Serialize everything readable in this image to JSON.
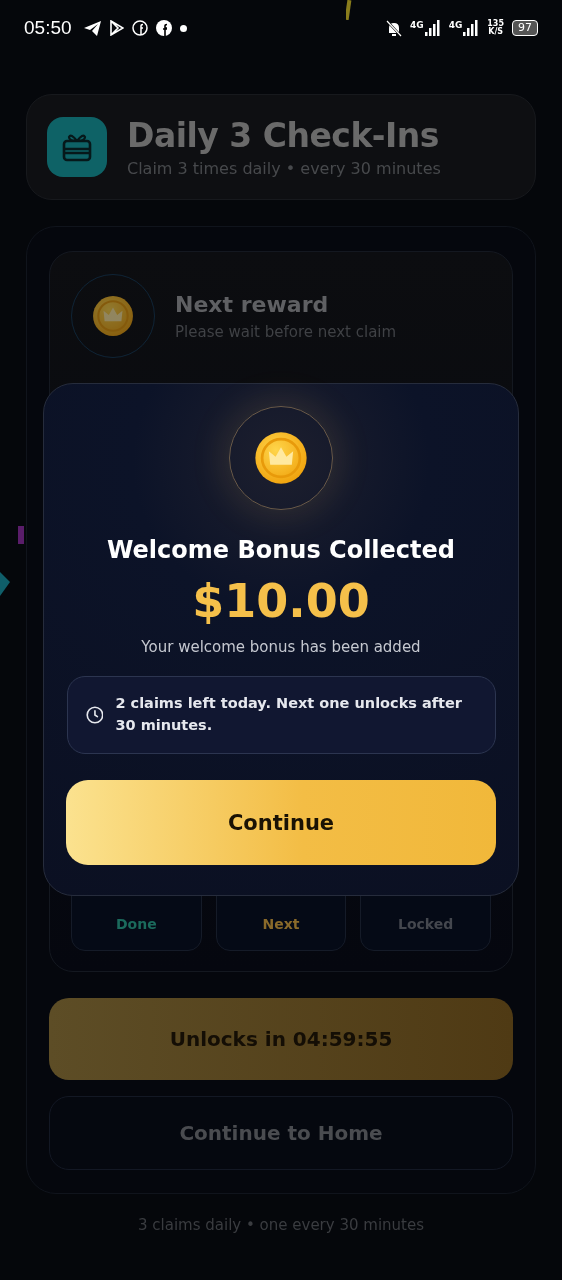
{
  "status_bar": {
    "time": "05:50",
    "network_1": "4G",
    "network_2": "4G",
    "speed": "135",
    "speed_unit": "K/S",
    "battery": "97"
  },
  "header": {
    "title": "Daily 3 Check-Ins",
    "subtitle": "Claim 3 times daily • every 30 minutes"
  },
  "next_reward": {
    "title": "Next reward",
    "subtitle": "Please wait before next claim"
  },
  "days": [
    {
      "label": "Done",
      "kind": "done"
    },
    {
      "label": "Next",
      "kind": "next"
    },
    {
      "label": "Locked",
      "kind": "locked"
    }
  ],
  "unlock_button": "Unlocks in 04:59:55",
  "home_button": "Continue to Home",
  "footer": "3 claims daily • one every 30 minutes",
  "modal": {
    "title": "Welcome Bonus Collected",
    "amount": "$10.00",
    "message": "Your welcome bonus has been added",
    "info": "2 claims left today. Next one unlocks after 30 minutes.",
    "button": "Continue"
  }
}
